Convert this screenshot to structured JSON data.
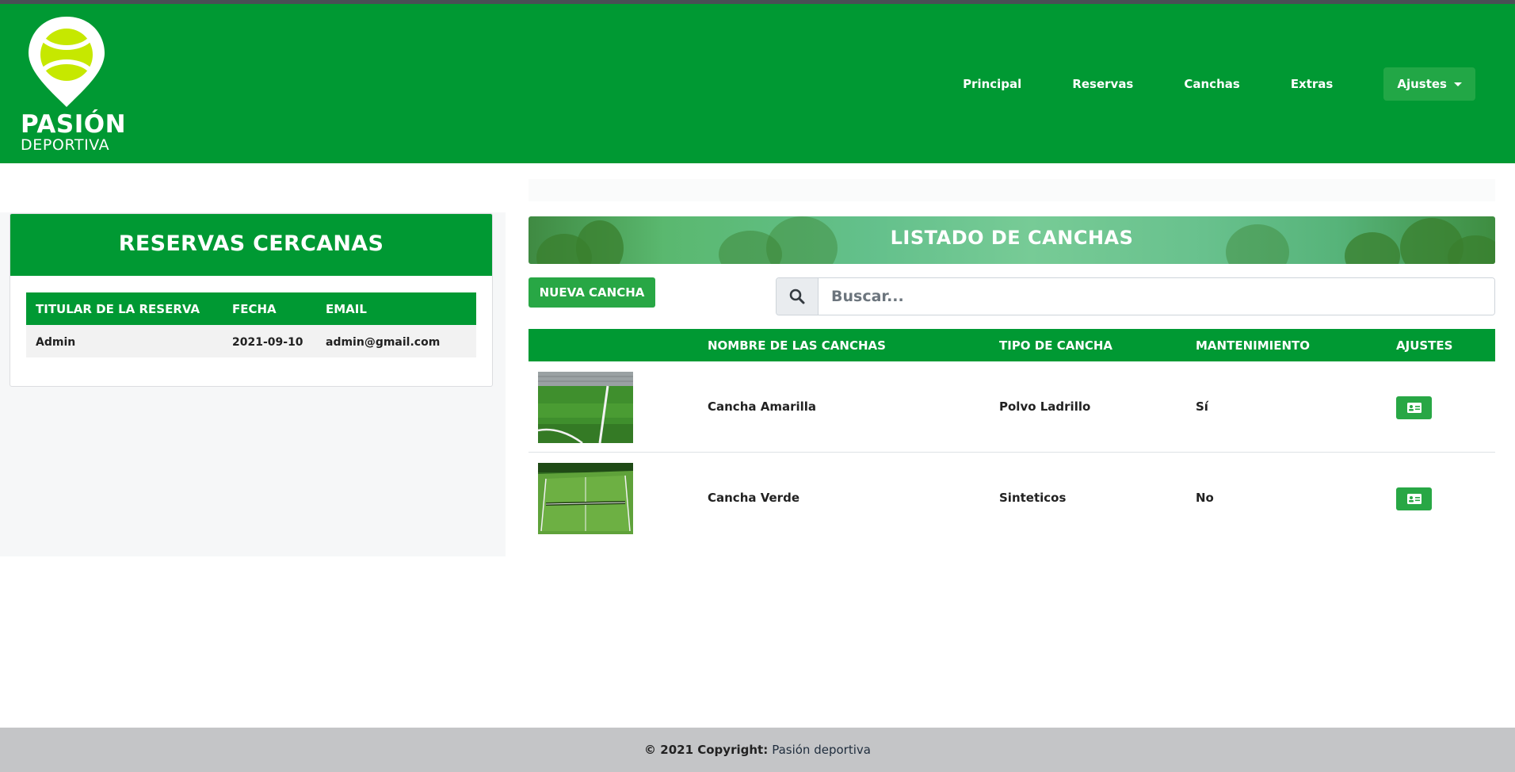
{
  "brand": {
    "name": "PASIÓN",
    "subtitle": "DEPORTIVA",
    "accent": "#009933",
    "ball_color": "#c6e800"
  },
  "nav": {
    "items": [
      {
        "label": "Principal"
      },
      {
        "label": "Reservas"
      },
      {
        "label": "Canchas"
      },
      {
        "label": "Extras"
      }
    ],
    "dropdown_label": "Ajustes"
  },
  "reservas": {
    "title": "RESERVAS CERCANAS",
    "headers": [
      "TITULAR DE LA RESERVA",
      "FECHA",
      "EMAIL"
    ],
    "rows": [
      {
        "titular": "Admin",
        "fecha": "2021-09-10",
        "email": "admin@gmail.com"
      }
    ]
  },
  "canchas": {
    "banner_title": "LISTADO DE CANCHAS",
    "new_button": "NUEVA CANCHA",
    "search_placeholder": "Buscar...",
    "headers": [
      "",
      "NOMBRE DE LAS CANCHAS",
      "TIPO DE CANCHA",
      "MANTENIMIENTO",
      "AJUSTES"
    ],
    "rows": [
      {
        "nombre": "Cancha Amarilla",
        "tipo": "Polvo Ladrillo",
        "mantenimiento": "Sí",
        "thumb": "soccer-field-corner"
      },
      {
        "nombre": "Cancha Verde",
        "tipo": "Sinteticos",
        "mantenimiento": "No",
        "thumb": "tennis-court-aerial"
      }
    ]
  },
  "footer": {
    "prefix": "© 2021 Copyright:",
    "brand": "Pasión deportiva"
  },
  "icons": {
    "search": "search-icon",
    "edit": "id-card-icon",
    "dropdown": "caret-down-icon"
  }
}
